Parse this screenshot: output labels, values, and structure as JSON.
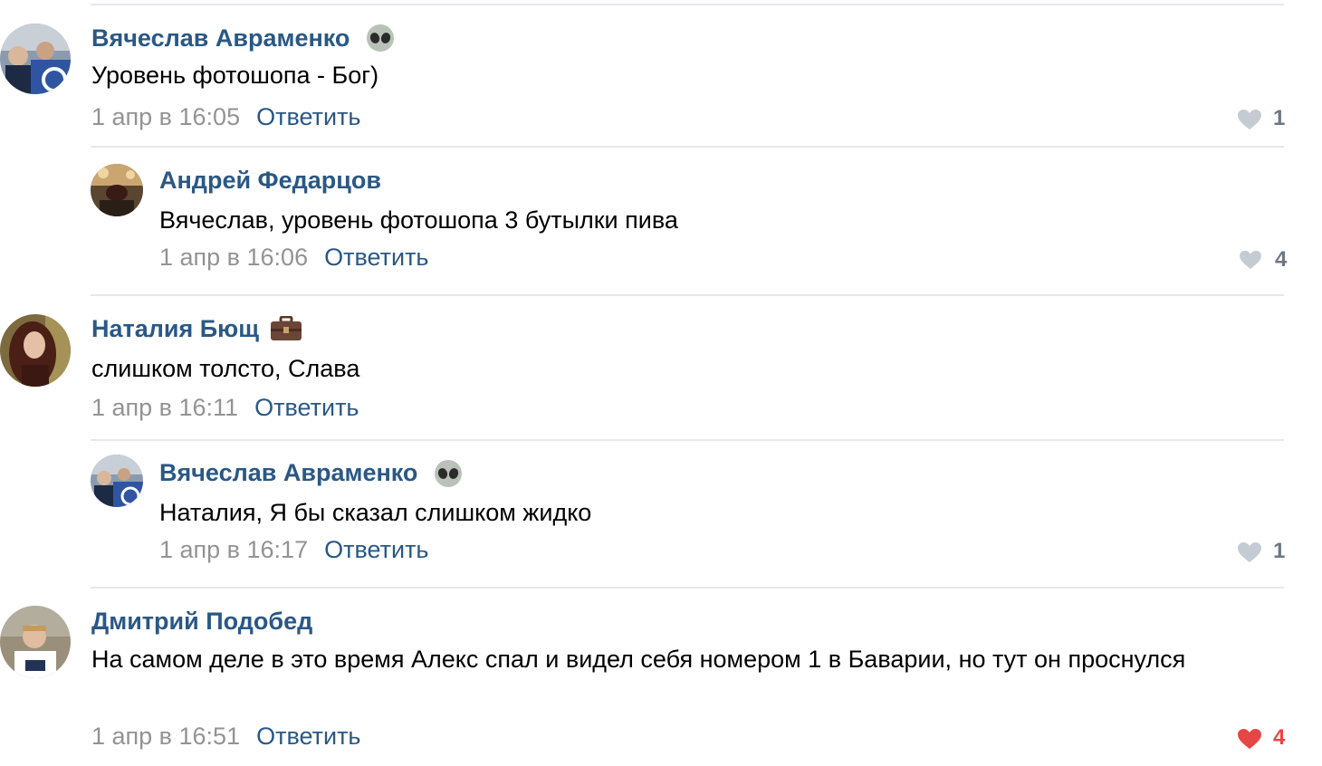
{
  "comments": [
    {
      "author": "Вячеслав Авраменко",
      "badge": "alien-emoji",
      "text": "Уровень фотошопа - Бог)",
      "date": "1 апр в 16:05",
      "reply": "Ответить",
      "likes": "1",
      "liked": false
    },
    {
      "author": "Андрей Федарцов",
      "badge": "",
      "text": "Вячеслав, уровень фотошопа 3 бутылки пива",
      "date": "1 апр в 16:06",
      "reply": "Ответить",
      "likes": "4",
      "liked": false
    },
    {
      "author": "Наталия Бющ",
      "badge": "briefcase-emoji",
      "text": "слишком толсто, Слава",
      "date": "1 апр в 16:11",
      "reply": "Ответить",
      "likes": "",
      "liked": false
    },
    {
      "author": "Вячеслав Авраменко",
      "badge": "alien-emoji",
      "text": "Наталия, Я бы сказал слишком жидко",
      "date": "1 апр в 16:17",
      "reply": "Ответить",
      "likes": "1",
      "liked": false
    },
    {
      "author": "Дмитрий Подобед",
      "badge": "",
      "text": "На самом деле в это время Алекс спал и видел себя номером 1 в Баварии, но тут он проснулся",
      "date": "1 апр в 16:51",
      "reply": "Ответить",
      "likes": "4",
      "liked": true
    }
  ],
  "colors": {
    "link": "#2a5885",
    "date": "#939393",
    "like_gray": "#c5cbd3",
    "like_red": "#e64646",
    "separator": "#e7e8ec"
  }
}
